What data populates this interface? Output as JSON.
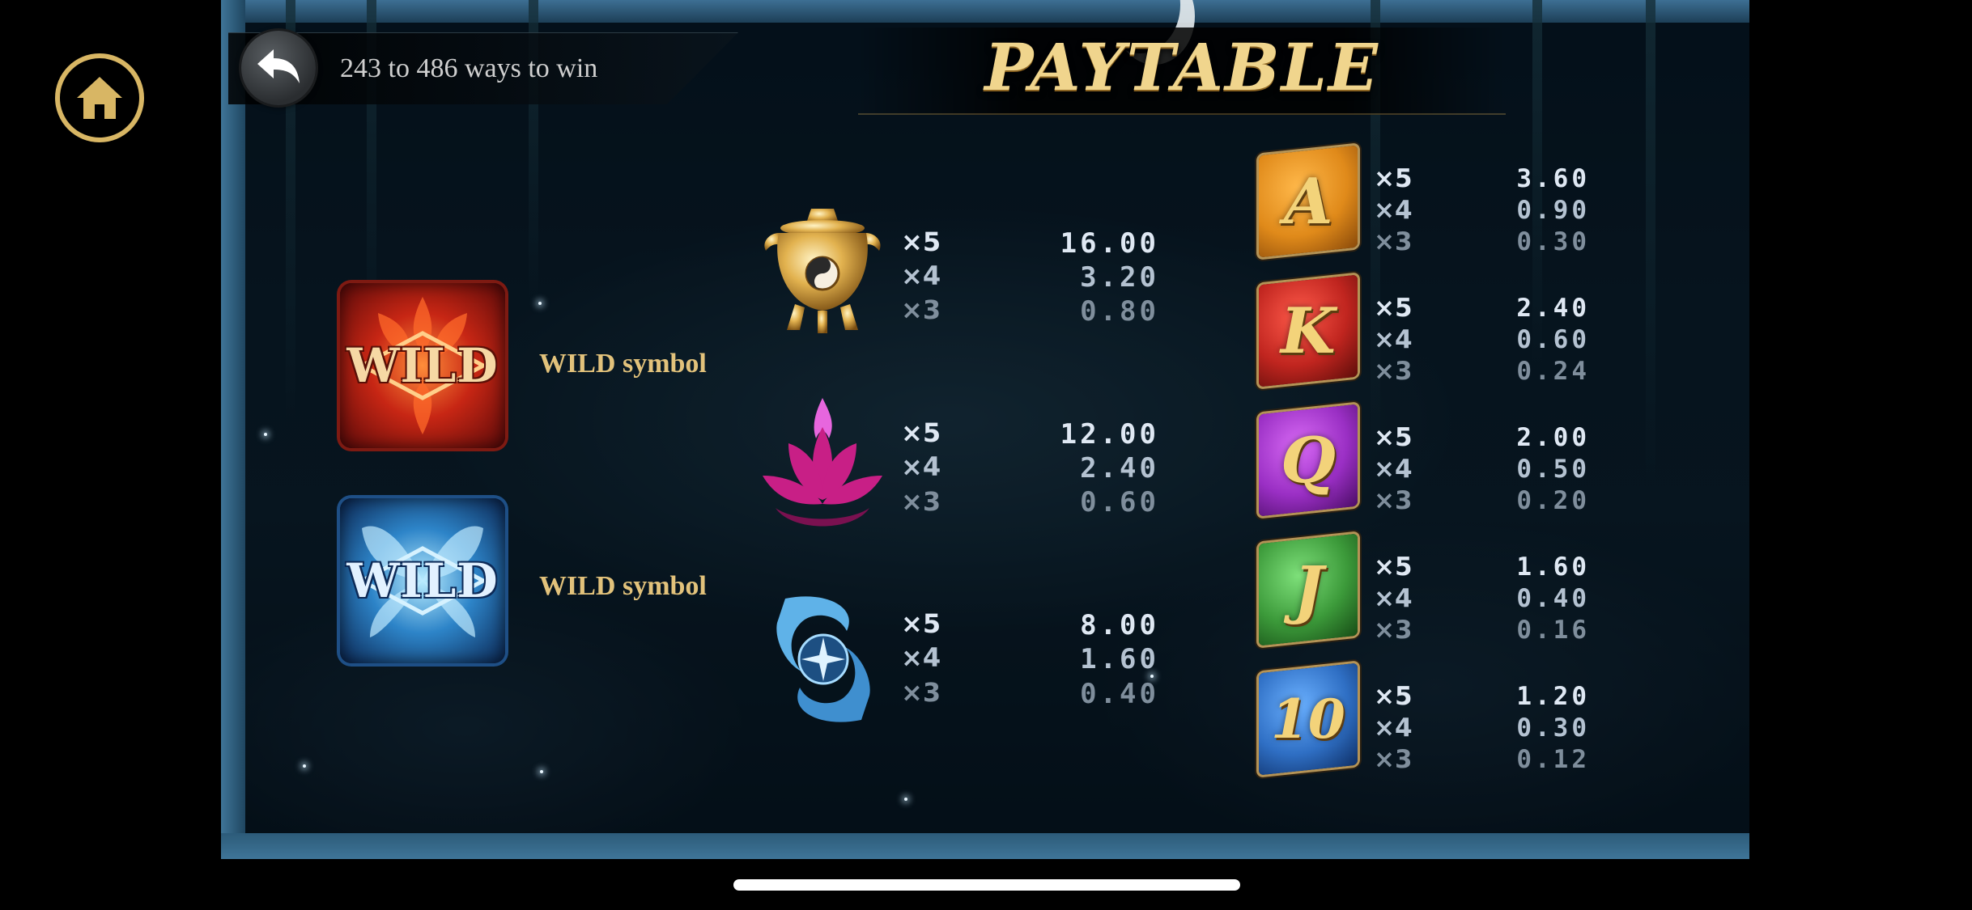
{
  "header": {
    "ways_text": "243 to 486 ways to win",
    "title": "PAYTABLE"
  },
  "wilds": [
    {
      "symbol": "WILD",
      "label": "WILD symbol"
    },
    {
      "symbol": "WILD",
      "label": "WILD symbol"
    }
  ],
  "high_symbols": [
    {
      "icon": "golden-incense-burner-icon",
      "multipliers": [
        "×5",
        "×4",
        "×3"
      ],
      "values": [
        "16.00",
        "3.20",
        "0.80"
      ]
    },
    {
      "icon": "purple-lotus-icon",
      "multipliers": [
        "×5",
        "×4",
        "×3"
      ],
      "values": [
        "12.00",
        "2.40",
        "0.60"
      ]
    },
    {
      "icon": "blue-ice-swirl-icon",
      "multipliers": [
        "×5",
        "×4",
        "×3"
      ],
      "values": [
        "8.00",
        "1.60",
        "0.40"
      ]
    }
  ],
  "card_symbols": [
    {
      "letter": "A",
      "color": "#e08a1a",
      "multipliers": [
        "×5",
        "×4",
        "×3"
      ],
      "values": [
        "3.60",
        "0.90",
        "0.30"
      ]
    },
    {
      "letter": "K",
      "color": "#c0251f",
      "multipliers": [
        "×5",
        "×4",
        "×3"
      ],
      "values": [
        "2.40",
        "0.60",
        "0.24"
      ]
    },
    {
      "letter": "Q",
      "color": "#9a2fc4",
      "multipliers": [
        "×5",
        "×4",
        "×3"
      ],
      "values": [
        "2.00",
        "0.50",
        "0.20"
      ]
    },
    {
      "letter": "J",
      "color": "#3c9a3a",
      "multipliers": [
        "×5",
        "×4",
        "×3"
      ],
      "values": [
        "1.60",
        "0.40",
        "0.16"
      ]
    },
    {
      "letter": "10",
      "color": "#2f6fc4",
      "multipliers": [
        "×5",
        "×4",
        "×3"
      ],
      "values": [
        "1.20",
        "0.30",
        "0.12"
      ]
    }
  ],
  "colors": {
    "gold_accent": "#d8b664",
    "frame_blue": "#3f7598"
  }
}
